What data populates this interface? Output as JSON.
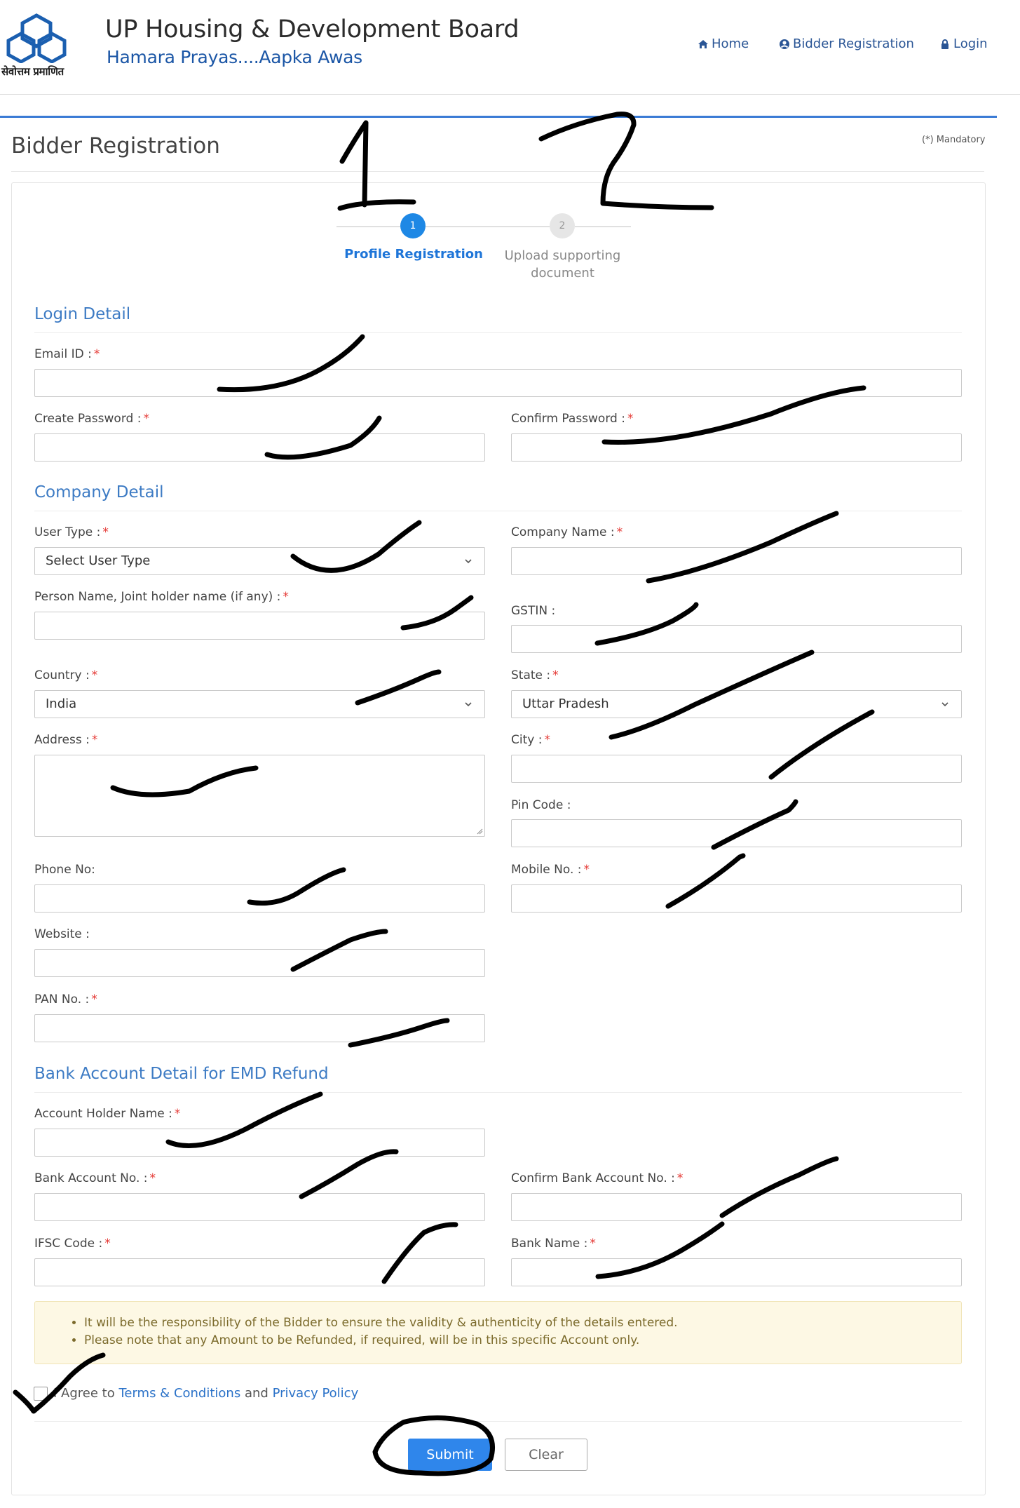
{
  "header": {
    "logo_caption": "सेवोत्तम प्रमाणित",
    "title": "UP Housing & Development Board",
    "tagline": "Hamara Prayas....Aapka Awas",
    "nav": {
      "home": "Home",
      "bidder_registration": "Bidder Registration",
      "login": "Login"
    }
  },
  "page": {
    "title": "Bidder Registration",
    "mandatory_note": "(*) Mandatory"
  },
  "stepper": {
    "steps": [
      {
        "number": "1",
        "label": "Profile Registration",
        "active": true
      },
      {
        "number": "2",
        "label_line1": "Upload supporting",
        "label_line2": "document",
        "active": false
      }
    ]
  },
  "sections": {
    "login": "Login Detail",
    "company": "Company Detail",
    "bank": "Bank Account Detail for EMD Refund"
  },
  "fields": {
    "email": "Email ID :",
    "create_password": "Create Password :",
    "confirm_password": "Confirm Password :",
    "user_type": "User Type :",
    "user_type_value": "Select User Type",
    "company_name": "Company Name :",
    "person_name": "Person Name, Joint holder name (if any) :",
    "gstin": "GSTIN :",
    "country": "Country :",
    "country_value": "India",
    "state": "State :",
    "state_value": "Uttar Pradesh",
    "address": "Address :",
    "city": "City :",
    "pin_code": "Pin Code :",
    "phone": "Phone No:",
    "mobile": "Mobile No. :",
    "website": "Website :",
    "pan": "PAN No. :",
    "account_holder": "Account Holder Name :",
    "bank_account": "Bank Account No. :",
    "confirm_bank_account": "Confirm Bank Account No. :",
    "ifsc": "IFSC Code :",
    "bank_name": "Bank Name :"
  },
  "required_mark": "*",
  "notes": [
    "It will be the responsibility of the Bidder to ensure the validity & authenticity of the details entered.",
    "Please note that any Amount to be Refunded, if required, will be in this specific Account only."
  ],
  "agree": {
    "prefix": "I Agree to",
    "terms": "Terms & Conditions",
    "and": "and",
    "privacy": "Privacy Policy"
  },
  "buttons": {
    "submit": "Submit",
    "clear": "Clear"
  },
  "handwriting": {
    "step_1": "1",
    "step_2": "2"
  },
  "colors": {
    "accent": "#1e88e5",
    "brand_blue": "#1b56a6",
    "section_blue": "#3d7bc4",
    "required_red": "#e53935"
  }
}
